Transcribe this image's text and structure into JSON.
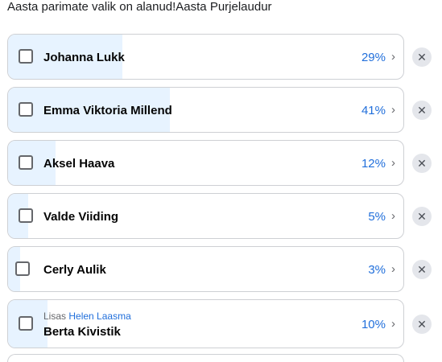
{
  "header": {
    "title": "Aasta parimate valik on alanud!Aasta Purjelaudur"
  },
  "options": [
    {
      "name": "Johanna Lukk",
      "percent": 29,
      "percent_label": "29%"
    },
    {
      "name": "Emma Viktoria Millend",
      "percent": 41,
      "percent_label": "41%"
    },
    {
      "name": "Aksel Haava",
      "percent": 12,
      "percent_label": "12%"
    },
    {
      "name": "Valde Viiding",
      "percent": 5,
      "percent_label": "5%"
    },
    {
      "name": "Cerly Aulik",
      "percent": 3,
      "percent_label": "3%"
    },
    {
      "name": "Berta Kivistik",
      "percent": 10,
      "percent_label": "10%",
      "added_prefix": "Lisas",
      "added_by": "Helen Laasma"
    }
  ],
  "icons": {
    "chevron": "chevron-right-icon",
    "remove": "close-icon"
  },
  "colors": {
    "fill": "#e7f3ff",
    "accent": "#216fdb",
    "border": "#ced0d4"
  }
}
